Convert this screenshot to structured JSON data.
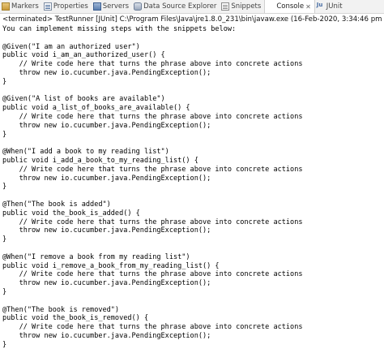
{
  "tabs": [
    {
      "name": "tab-markers",
      "icon": "markers-icon",
      "label": "Markers",
      "active": false
    },
    {
      "name": "tab-properties",
      "icon": "properties-icon",
      "label": "Properties",
      "active": false
    },
    {
      "name": "tab-servers",
      "icon": "servers-icon",
      "label": "Servers",
      "active": false
    },
    {
      "name": "tab-data-source-explorer",
      "icon": "data-source-icon",
      "label": "Data Source Explorer",
      "active": false
    },
    {
      "name": "tab-snippets",
      "icon": "snippets-icon",
      "label": "Snippets",
      "active": false
    },
    {
      "name": "tab-console",
      "icon": "console-icon",
      "label": "Console",
      "active": true,
      "close": "✕"
    },
    {
      "name": "tab-junit",
      "icon": "junit-icon",
      "label": "JUnit",
      "active": false
    }
  ],
  "status_line": "<terminated> TestRunner [JUnit] C:\\Program Files\\Java\\jre1.8.0_231\\bin\\javaw.exe (16-Feb-2020, 3:34:46 pm)",
  "console_lines": [
    "You can implement missing steps with the snippets below:",
    "",
    "@Given(\"I am an authorized user\")",
    "public void i_am_an_authorized_user() {",
    "    // Write code here that turns the phrase above into concrete actions",
    "    throw new io.cucumber.java.PendingException();",
    "}",
    "",
    "@Given(\"A list of books are available\")",
    "public void a_list_of_books_are_available() {",
    "    // Write code here that turns the phrase above into concrete actions",
    "    throw new io.cucumber.java.PendingException();",
    "}",
    "",
    "@When(\"I add a book to my reading list\")",
    "public void i_add_a_book_to_my_reading_list() {",
    "    // Write code here that turns the phrase above into concrete actions",
    "    throw new io.cucumber.java.PendingException();",
    "}",
    "",
    "@Then(\"The book is added\")",
    "public void the_book_is_added() {",
    "    // Write code here that turns the phrase above into concrete actions",
    "    throw new io.cucumber.java.PendingException();",
    "}",
    "",
    "@When(\"I remove a book from my reading list\")",
    "public void i_remove_a_book_from_my_reading_list() {",
    "    // Write code here that turns the phrase above into concrete actions",
    "    throw new io.cucumber.java.PendingException();",
    "}",
    "",
    "@Then(\"The book is removed\")",
    "public void the_book_is_removed() {",
    "    // Write code here that turns the phrase above into concrete actions",
    "    throw new io.cucumber.java.PendingException();",
    "}"
  ],
  "colors": {
    "text": "#000000",
    "tabbar_bg": "#f2f2f2",
    "background": "#ffffff"
  }
}
